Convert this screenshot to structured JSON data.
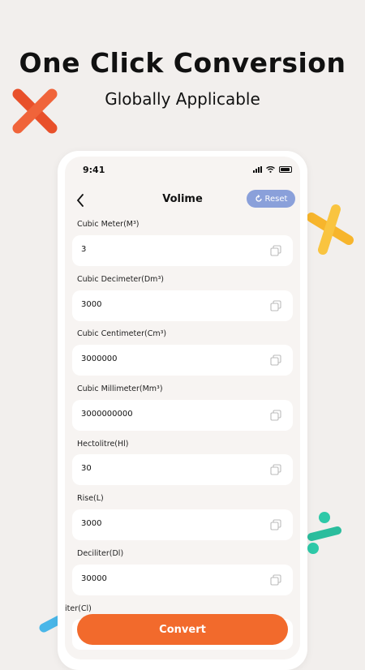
{
  "promo": {
    "headline": "One Click Conversion",
    "subhead": "Globally Applicable"
  },
  "status_bar": {
    "time": "9:41"
  },
  "nav": {
    "title": "Volime",
    "reset_label": "Reset"
  },
  "fields": [
    {
      "label": "Cubic Meter(M³)",
      "value": "3"
    },
    {
      "label": "Cubic Decimeter(Dm³)",
      "value": "3000"
    },
    {
      "label": "Cubic Centimeter(Cm³)",
      "value": "3000000"
    },
    {
      "label": "Cubic Millimeter(Mm³)",
      "value": "3000000000"
    },
    {
      "label": "Hectolitre(Hl)",
      "value": "30"
    },
    {
      "label": "Rise(L)",
      "value": "3000"
    },
    {
      "label": "Deciliter(Dl)",
      "value": "30000"
    },
    {
      "label": "iter(Cl)",
      "value": ""
    }
  ],
  "actions": {
    "convert_label": "Convert"
  },
  "colors": {
    "accent": "#f26a2c",
    "reset": "#8aa0da",
    "background": "#f2efed"
  }
}
